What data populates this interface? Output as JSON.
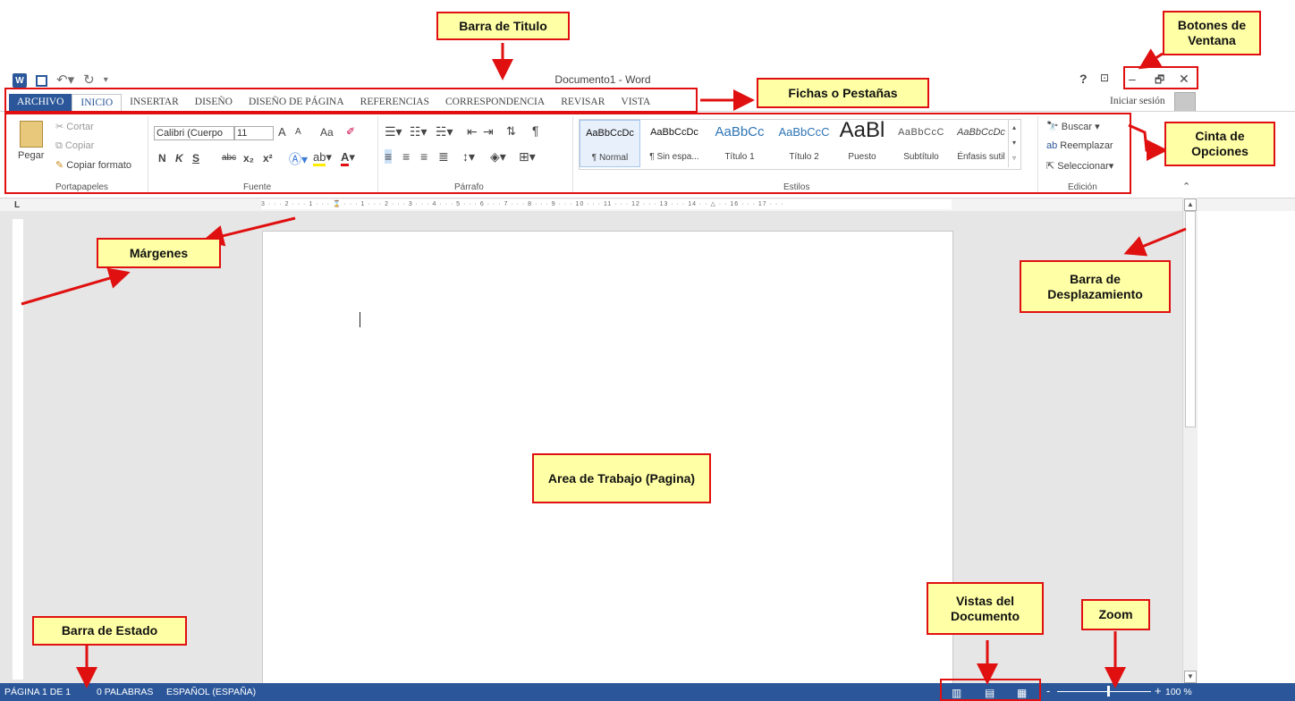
{
  "title_bar": {
    "document_title": "Documento1 - Word",
    "sign_in": "Iniciar sesión",
    "help": "?",
    "restore_ribbon": "⊡",
    "minimize": "–",
    "restore": "🗗",
    "close": "✕"
  },
  "tabs": [
    "ARCHIVO",
    "INICIO",
    "INSERTAR",
    "DISEÑO",
    "DISEÑO DE PÁGINA",
    "REFERENCIAS",
    "CORRESPONDENCIA",
    "REVISAR",
    "VISTA"
  ],
  "clipboard": {
    "paste": "Pegar",
    "cut": "Cortar",
    "copy": "Copiar",
    "format_painter": "Copiar formato",
    "group": "Portapapeles"
  },
  "font": {
    "name": "Calibri (Cuerpo",
    "size": "11",
    "grow": "A",
    "shrink": "A",
    "case": "Aa",
    "bold": "N",
    "italic": "K",
    "underline": "S",
    "strike": "abc",
    "sub": "x₂",
    "sup": "x²",
    "group": "Fuente"
  },
  "paragraph": {
    "group": "Párrafo",
    "pilcrow": "¶"
  },
  "styles": {
    "group": "Estilos",
    "items": [
      {
        "sample": "AaBbCcDc",
        "name": "¶ Normal"
      },
      {
        "sample": "AaBbCcDc",
        "name": "¶ Sin espa..."
      },
      {
        "sample": "AaBbCc",
        "name": "Título 1"
      },
      {
        "sample": "AaBbCcC",
        "name": "Título 2"
      },
      {
        "sample": "AaBl",
        "name": "Puesto"
      },
      {
        "sample": "AaBbCcC",
        "name": "Subtítulo"
      },
      {
        "sample": "AaBbCcDc",
        "name": "Énfasis sutil"
      }
    ]
  },
  "editing": {
    "find": "Buscar",
    "replace": "Reemplazar",
    "select": "Seleccionar",
    "group": "Edición"
  },
  "ruler": {
    "horizontal_text": "3 · · · 2 · · · 1 · · · ⌛ · · · 1 · · · 2 · · · 3 · · · 4 · · · 5 · · · 6 · · · 7 · · · 8 · · · 9 · · · 10 · · · 11 · · · 12 · · · 13 · · · 14 · · △ · · 16 · · · 17 · · ·",
    "tab_selector": "L"
  },
  "status_bar": {
    "page": "PÁGINA 1 DE 1",
    "words": "0 PALABRAS",
    "language": "ESPAÑOL (ESPAÑA)",
    "zoom": "100 %",
    "zoom_minus": "-",
    "zoom_plus": "+"
  },
  "annotations": {
    "title_bar": "Barra de Titulo",
    "window_buttons": "Botones de Ventana",
    "tabs": "Fichas o Pestañas",
    "ribbon": "Cinta de Opciones",
    "margins": "Márgenes",
    "scrollbar": "Barra de Desplazamiento",
    "work_area": "Area de Trabajo (Pagina)",
    "status_bar": "Barra de Estado",
    "views": "Vistas del Documento",
    "zoom": "Zoom"
  },
  "colors": {
    "accent": "#2b579a",
    "annotation_bg": "#ffffa6",
    "annotation_border": "#e01010"
  }
}
